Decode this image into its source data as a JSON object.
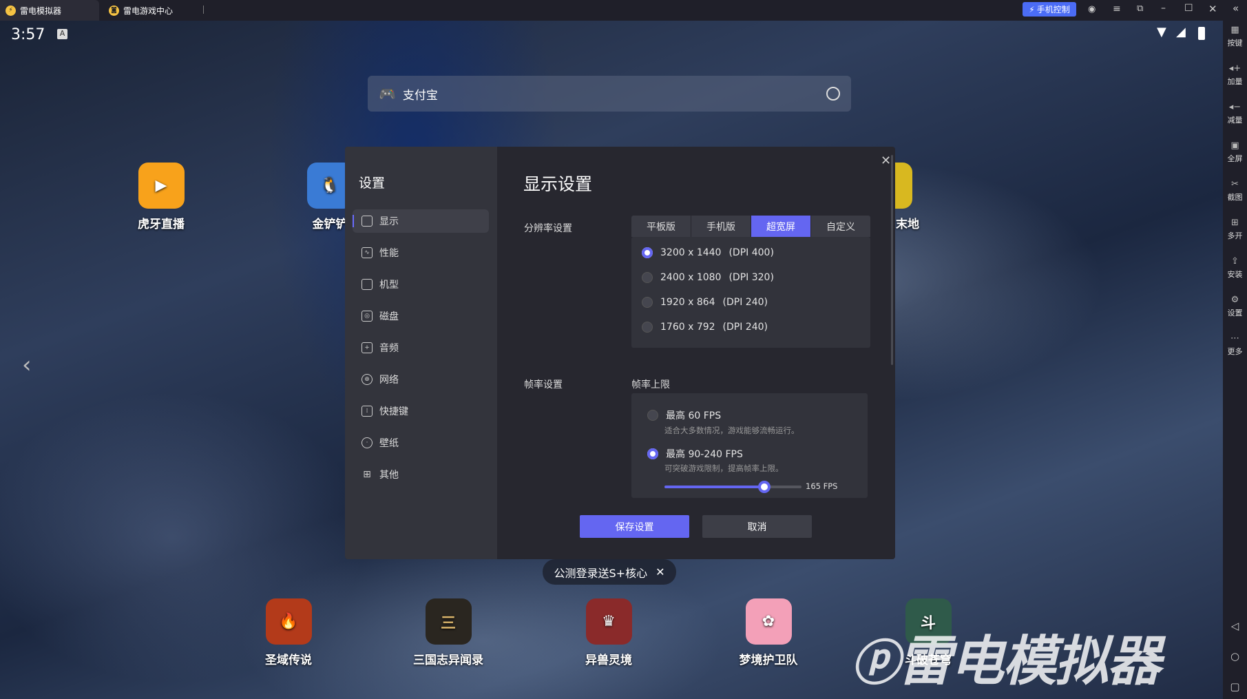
{
  "titlebar": {
    "tabs": [
      {
        "label": "雷电模拟器"
      },
      {
        "label": "雷电游戏中心"
      }
    ],
    "phone_control": "手机控制"
  },
  "status": {
    "time": "3:57"
  },
  "search": {
    "placeholder": "支付宝"
  },
  "desktop_apps": [
    {
      "label": "虎牙直播"
    },
    {
      "label": "金铲铲"
    },
    {
      "label": "末地"
    }
  ],
  "dock_apps": [
    {
      "label": "圣域传说"
    },
    {
      "label": "三国志异闻录"
    },
    {
      "label": "异兽灵境"
    },
    {
      "label": "梦境护卫队"
    },
    {
      "label": "斗破苍穹"
    }
  ],
  "banner": {
    "text": "公测登录送S+核心"
  },
  "watermark": "雷电模拟器",
  "right_toolbar": [
    {
      "label": "按键",
      "icon": "keyboard-icon"
    },
    {
      "label": "加量",
      "icon": "volume-up-icon"
    },
    {
      "label": "减量",
      "icon": "volume-down-icon"
    },
    {
      "label": "全屏",
      "icon": "fullscreen-icon"
    },
    {
      "label": "截图",
      "icon": "scissors-icon"
    },
    {
      "label": "多开",
      "icon": "multi-instance-icon"
    },
    {
      "label": "安装",
      "icon": "apk-install-icon"
    },
    {
      "label": "设置",
      "icon": "gear-icon"
    },
    {
      "label": "更多",
      "icon": "more-icon"
    }
  ],
  "settings": {
    "title": "设置",
    "nav": [
      {
        "label": "显示"
      },
      {
        "label": "性能"
      },
      {
        "label": "机型"
      },
      {
        "label": "磁盘"
      },
      {
        "label": "音频"
      },
      {
        "label": "网络"
      },
      {
        "label": "快捷键"
      },
      {
        "label": "壁纸"
      },
      {
        "label": "其他"
      }
    ],
    "heading": "显示设置",
    "resolution_label": "分辨率设置",
    "resolution_tabs": [
      {
        "label": "平板版"
      },
      {
        "label": "手机版"
      },
      {
        "label": "超宽屏"
      },
      {
        "label": "自定义"
      }
    ],
    "resolution_options": [
      {
        "res": "3200 x 1440",
        "dpi": "(DPI 400)"
      },
      {
        "res": "2400 x 1080",
        "dpi": "(DPI 320)"
      },
      {
        "res": "1920 x 864",
        "dpi": "(DPI 240)"
      },
      {
        "res": "1760 x 792",
        "dpi": "(DPI 240)"
      }
    ],
    "fps_label": "帧率设置",
    "fps_limit_label": "帧率上限",
    "fps_options": [
      {
        "label": "最高 60 FPS",
        "desc": "适合大多数情况，游戏能够流畅运行。"
      },
      {
        "label": "最高 90-240 FPS",
        "desc": "可突破游戏限制，提高帧率上限。"
      }
    ],
    "fps_slider": {
      "value_label": "165 FPS",
      "fill_percent": 73
    },
    "save": "保存设置",
    "cancel": "取消"
  },
  "colors": {
    "accent": "#6466f1"
  }
}
